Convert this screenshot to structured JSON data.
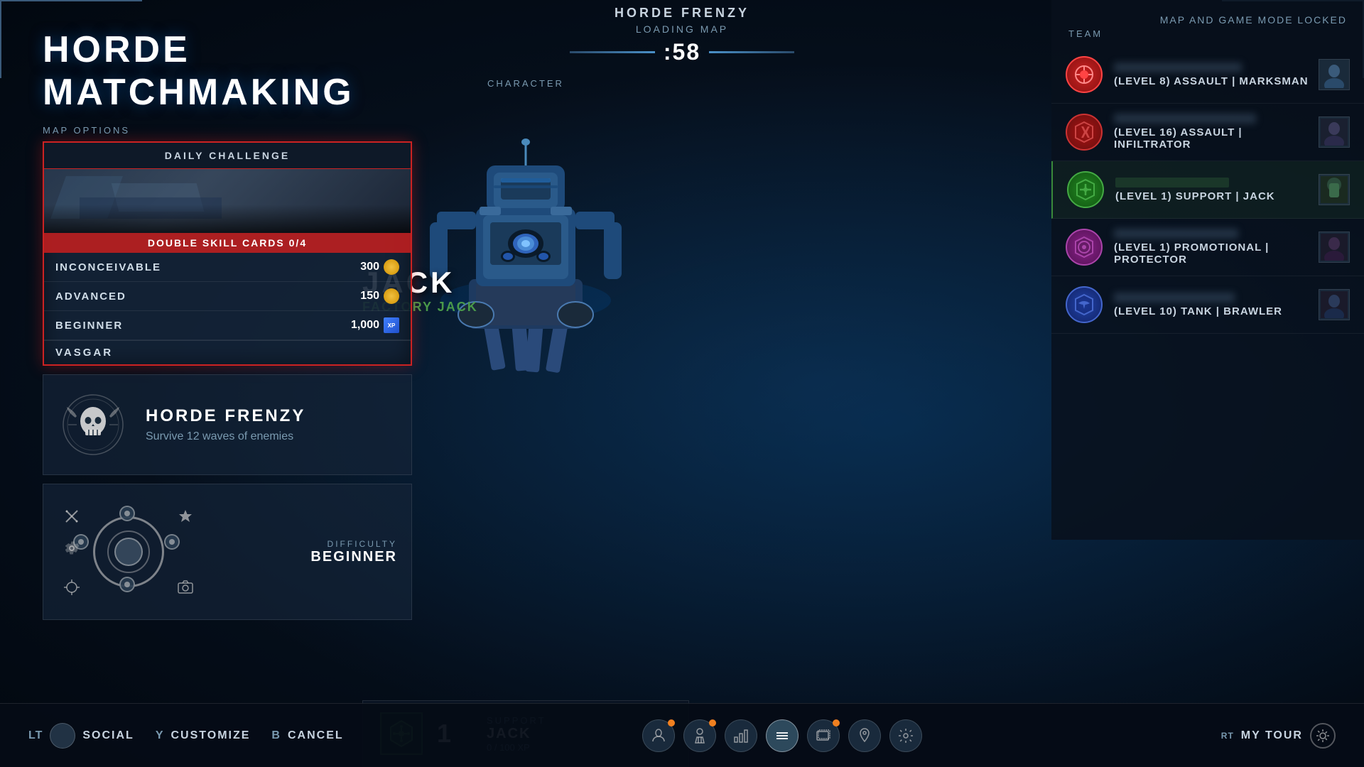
{
  "header": {
    "mode": "HORDE FRENZY",
    "loading": "LOADING MAP",
    "timer": ":58"
  },
  "title": "HORDE MATCHMAKING",
  "left": {
    "map_options_label": "MAP OPTIONS",
    "card": {
      "daily_challenge": "DAILY CHALLENGE",
      "bonus": "DOUBLE SKILL CARDS 0/4",
      "map_name": "VASGAR",
      "difficulties": [
        {
          "name": "INCONCEIVABLE",
          "reward": "300",
          "type": "coin"
        },
        {
          "name": "ADVANCED",
          "reward": "150",
          "type": "coin"
        },
        {
          "name": "BEGINNER",
          "reward": "1,000",
          "type": "xp"
        }
      ]
    },
    "frenzy": {
      "title": "HORDE FRENZY",
      "desc": "Survive 12 waves of enemies"
    },
    "difficulty": {
      "label": "DIFFICULTY",
      "value": "BEGINNER"
    }
  },
  "character": {
    "label": "CHARACTER",
    "name": "JACK",
    "skin": "FACTORY JACK",
    "class": "SUPPORT",
    "level": "1",
    "xp": "0 / 100 XP"
  },
  "right": {
    "map_locked": "MAP AND GAME MODE LOCKED",
    "team_label": "TEAM",
    "members": [
      {
        "level": "(LEVEL 8)",
        "class": "ASSAULT",
        "role": "MARKSMAN",
        "badge_type": "red"
      },
      {
        "level": "(LEVEL 16)",
        "class": "ASSAULT",
        "role": "INFILTRATOR",
        "badge_type": "red2"
      },
      {
        "level": "(LEVEL 1)",
        "class": "SUPPORT",
        "role": "JACK",
        "badge_type": "green"
      },
      {
        "level": "(LEVEL 1)",
        "class": "PROMOTIONAL",
        "role": "PROTECTOR",
        "badge_type": "purple"
      },
      {
        "level": "(LEVEL 10)",
        "class": "TANK",
        "role": "BRAWLER",
        "badge_type": "blue"
      }
    ]
  },
  "bottom": {
    "social_key": "LT",
    "social_label": "SOCIAL",
    "customize_key": "Y",
    "customize_label": "CUSTOMIZE",
    "cancel_key": "B",
    "cancel_label": "CANCEL",
    "my_tour_key": "RT",
    "my_tour_label": "MY TOUR"
  }
}
